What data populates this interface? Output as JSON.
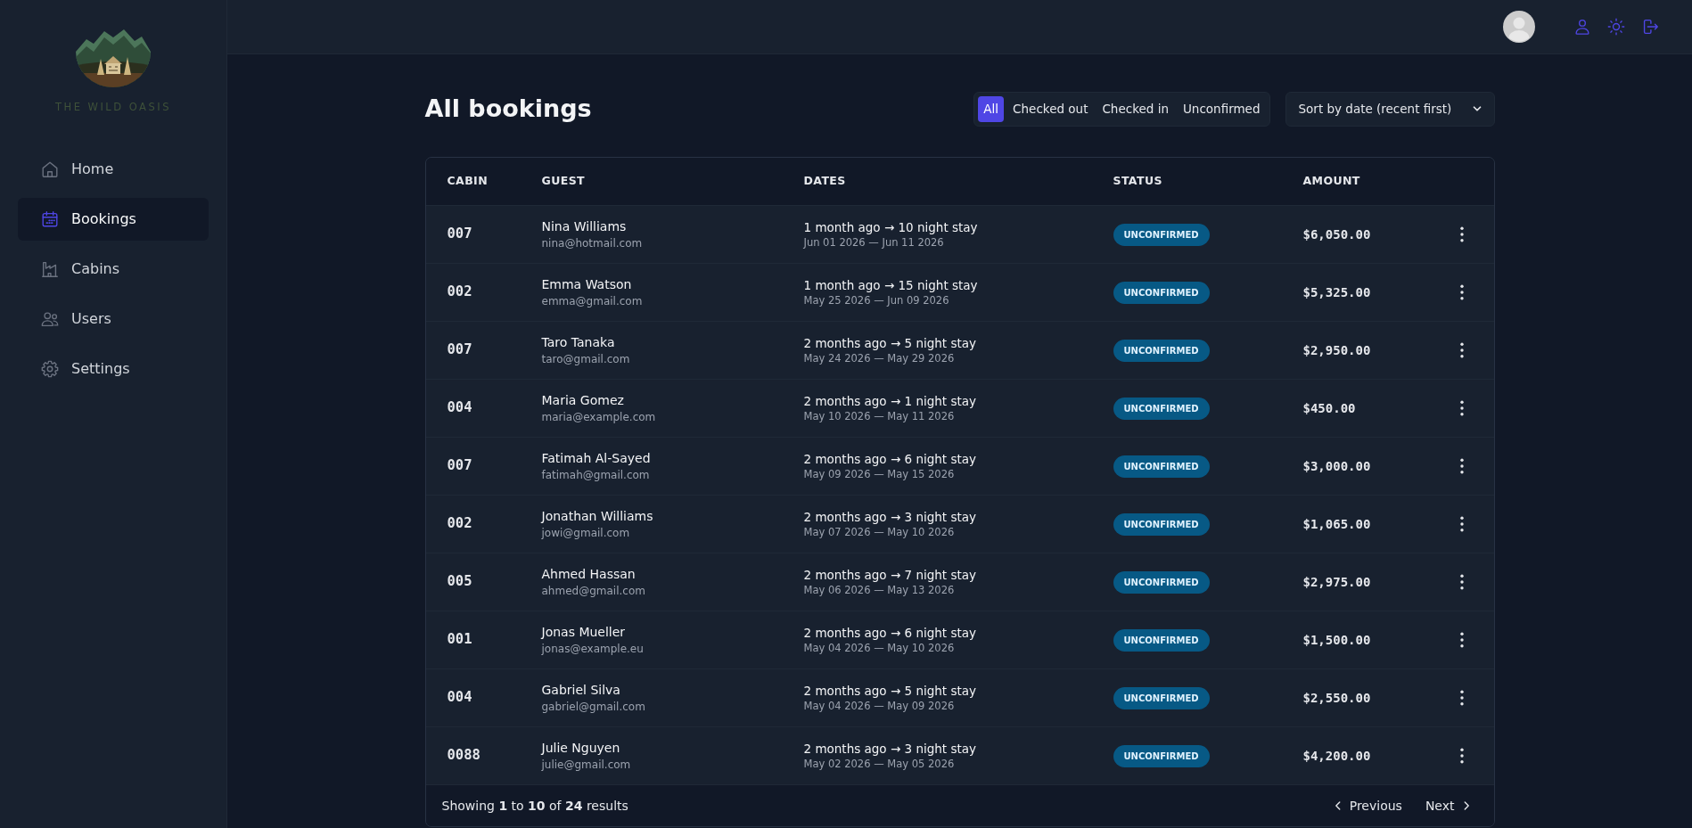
{
  "sidebar": {
    "brand": "THE WILD OASIS",
    "items": [
      {
        "label": "Home",
        "selected": false
      },
      {
        "label": "Bookings",
        "selected": true
      },
      {
        "label": "Cabins",
        "selected": false
      },
      {
        "label": "Users",
        "selected": false
      },
      {
        "label": "Settings",
        "selected": false
      }
    ]
  },
  "page": {
    "title": "All bookings",
    "filters": [
      {
        "label": "All",
        "selected": true
      },
      {
        "label": "Checked out",
        "selected": false
      },
      {
        "label": "Checked in",
        "selected": false
      },
      {
        "label": "Unconfirmed",
        "selected": false
      }
    ],
    "sort": {
      "value": "Sort by date (recent first)"
    }
  },
  "table": {
    "columns": [
      "CABIN",
      "GUEST",
      "DATES",
      "STATUS",
      "AMOUNT"
    ],
    "rows": [
      {
        "cabin": "007",
        "guest": "Nina Williams",
        "email": "nina@hotmail.com",
        "stay": "1 month ago → 10 night stay",
        "dates": "Jun 01 2026 — Jun 11 2026",
        "status": "UNCONFIRMED",
        "amount": "$6,050.00"
      },
      {
        "cabin": "002",
        "guest": "Emma Watson",
        "email": "emma@gmail.com",
        "stay": "1 month ago → 15 night stay",
        "dates": "May 25 2026 — Jun 09 2026",
        "status": "UNCONFIRMED",
        "amount": "$5,325.00"
      },
      {
        "cabin": "007",
        "guest": "Taro Tanaka",
        "email": "taro@gmail.com",
        "stay": "2 months ago → 5 night stay",
        "dates": "May 24 2026 — May 29 2026",
        "status": "UNCONFIRMED",
        "amount": "$2,950.00"
      },
      {
        "cabin": "004",
        "guest": "Maria Gomez",
        "email": "maria@example.com",
        "stay": "2 months ago → 1 night stay",
        "dates": "May 10 2026 — May 11 2026",
        "status": "UNCONFIRMED",
        "amount": "$450.00"
      },
      {
        "cabin": "007",
        "guest": "Fatimah Al-Sayed",
        "email": "fatimah@gmail.com",
        "stay": "2 months ago → 6 night stay",
        "dates": "May 09 2026 — May 15 2026",
        "status": "UNCONFIRMED",
        "amount": "$3,000.00"
      },
      {
        "cabin": "002",
        "guest": "Jonathan Williams",
        "email": "jowi@gmail.com",
        "stay": "2 months ago → 3 night stay",
        "dates": "May 07 2026 — May 10 2026",
        "status": "UNCONFIRMED",
        "amount": "$1,065.00"
      },
      {
        "cabin": "005",
        "guest": "Ahmed Hassan",
        "email": "ahmed@gmail.com",
        "stay": "2 months ago → 7 night stay",
        "dates": "May 06 2026 — May 13 2026",
        "status": "UNCONFIRMED",
        "amount": "$2,975.00"
      },
      {
        "cabin": "001",
        "guest": "Jonas Mueller",
        "email": "jonas@example.eu",
        "stay": "2 months ago → 6 night stay",
        "dates": "May 04 2026 — May 10 2026",
        "status": "UNCONFIRMED",
        "amount": "$1,500.00"
      },
      {
        "cabin": "004",
        "guest": "Gabriel Silva",
        "email": "gabriel@gmail.com",
        "stay": "2 months ago → 5 night stay",
        "dates": "May 04 2026 — May 09 2026",
        "status": "UNCONFIRMED",
        "amount": "$2,550.00"
      },
      {
        "cabin": "0088",
        "guest": "Julie Nguyen",
        "email": "julie@gmail.com",
        "stay": "2 months ago → 3 night stay",
        "dates": "May 02 2026 — May 05 2026",
        "status": "UNCONFIRMED",
        "amount": "$4,200.00"
      }
    ]
  },
  "pagination": {
    "summary": "Showing **1** to **10** of **24** results",
    "previous": "Previous",
    "next": "Next"
  }
}
